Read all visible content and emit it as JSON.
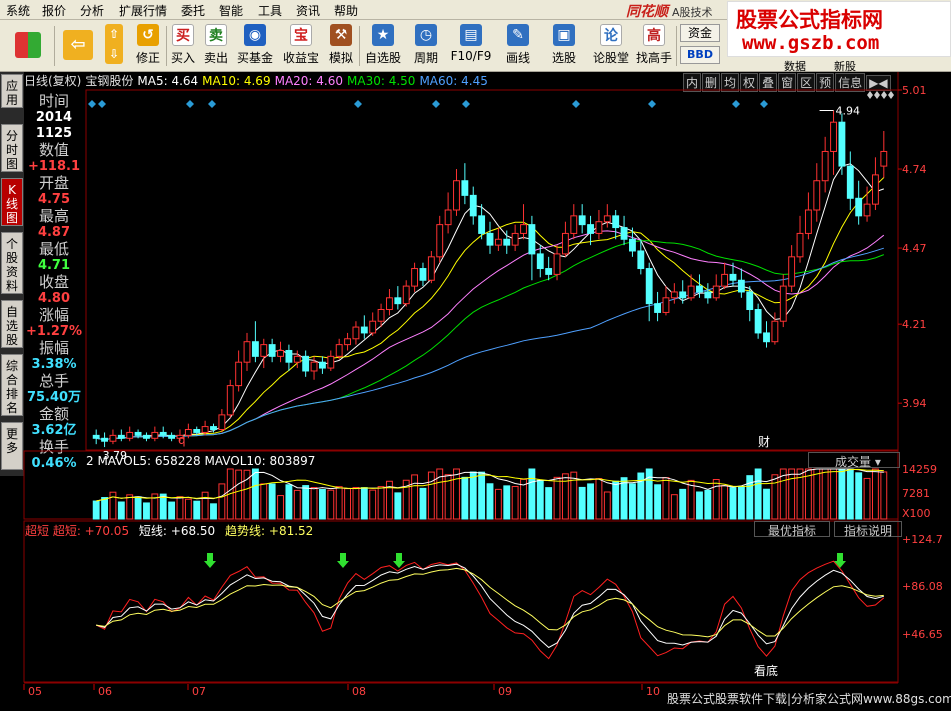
{
  "menu": [
    "系统",
    "报价",
    "分析",
    "扩展行情",
    "委托",
    "智能",
    "工具",
    "资讯",
    "帮助"
  ],
  "brand": {
    "name": "同花顺",
    "sub": "A股技术"
  },
  "watermark": {
    "title": "股票公式指标网",
    "url": "www.gszb.com"
  },
  "toolbar": {
    "buttons": [
      {
        "label": "修正",
        "icon": "refresh-icon",
        "color": "#e8a000",
        "glyph": "↺"
      },
      {
        "label": "买入",
        "icon": "buy-icon",
        "color": "#cc2020",
        "glyph": "买"
      },
      {
        "label": "卖出",
        "icon": "sell-icon",
        "color": "#208020",
        "glyph": "卖"
      },
      {
        "label": "买基金",
        "icon": "fund-icon",
        "color": "#2060c0",
        "glyph": "◉"
      },
      {
        "label": "收益宝",
        "icon": "profit-icon",
        "color": "#d02020",
        "glyph": "宝"
      },
      {
        "label": "模拟",
        "icon": "hammer-icon",
        "color": "#a05020",
        "glyph": "⚒"
      },
      {
        "label": "自选股",
        "icon": "star-folder-icon",
        "color": "#3070c0",
        "glyph": "★"
      },
      {
        "label": "周期",
        "icon": "clock-icon",
        "color": "#3070c0",
        "glyph": "◷"
      },
      {
        "label": "F10/F9",
        "icon": "f10-icon",
        "color": "#3070c0",
        "glyph": "▤"
      },
      {
        "label": "画线",
        "icon": "pen-icon",
        "color": "#3070c0",
        "glyph": "✎"
      },
      {
        "label": "选股",
        "icon": "monitor-icon",
        "color": "#3070c0",
        "glyph": "▣"
      },
      {
        "label": "论股堂",
        "icon": "forum-icon",
        "color": "#3070c0",
        "glyph": "论"
      },
      {
        "label": "找高手",
        "icon": "expert-icon",
        "color": "#c02020",
        "glyph": "高"
      }
    ],
    "extra": [
      "资金",
      "BBD",
      "数据",
      "新股"
    ]
  },
  "left_tabs": [
    "应用",
    "分时图",
    "K线图",
    "个股资料",
    "自选股",
    "综合排名",
    "更多"
  ],
  "stock": {
    "name": "宝钢股份",
    "period": "日线(复权)"
  },
  "ma_line": {
    "ma5": "MA5: 4.64",
    "ma10": "MA10: 4.69",
    "ma20": "MA20: 4.60",
    "ma30": "MA30: 4.50",
    "ma60": "MA60: 4.45"
  },
  "right_tools": [
    "内",
    "删",
    "均",
    "权",
    "叠",
    "窗",
    "区",
    "预",
    "信息"
  ],
  "info": [
    {
      "label": "时间",
      "value": "2014",
      "value2": "1125",
      "color": "#ffffff"
    },
    {
      "label": "数值",
      "value": "+118.1",
      "color": "#ff4040"
    },
    {
      "label": "开盘",
      "value": "4.75",
      "color": "#ff4040"
    },
    {
      "label": "最高",
      "value": "4.87",
      "color": "#ff4040"
    },
    {
      "label": "最低",
      "value": "4.71",
      "color": "#40ff40"
    },
    {
      "label": "收盘",
      "value": "4.80",
      "color": "#ff4040"
    },
    {
      "label": "涨幅",
      "value": "+1.27%",
      "color": "#ff4040"
    },
    {
      "label": "振幅",
      "value": "3.38%",
      "color": "#40e0ff"
    },
    {
      "label": "总手",
      "value": "75.40万",
      "color": "#40e0ff"
    },
    {
      "label": "金额",
      "value": "3.62亿",
      "color": "#40e0ff"
    },
    {
      "label": "换手",
      "value": "0.46%",
      "color": "#40e0ff"
    }
  ],
  "price_axis": [
    "5.01",
    "4.74",
    "4.47",
    "4.21",
    "3.94"
  ],
  "price_annotations": {
    "high": "4.94",
    "low": "3.79",
    "marker_q": "q",
    "marker_cai": "财"
  },
  "volume": {
    "header": "2 MAVOL5: 658228  MAVOL10: 803897",
    "tab": "成交量",
    "axis": [
      "14259",
      "7281",
      "X100"
    ]
  },
  "indicator": {
    "header_name": "超短 超短: +70.05",
    "short": "短线: +68.50",
    "trend": "趋势线: +81.52",
    "buttons": [
      "最优指标",
      "指标说明"
    ],
    "axis": [
      "+124.7",
      "+86.08",
      "+46.65"
    ],
    "label_bottom": "看底"
  },
  "months": [
    "05",
    "06",
    "07",
    "08",
    "09",
    "10"
  ],
  "footer": "股票公式股票软件下载|分析家公式网www.88gs.com",
  "colors": {
    "up": "#ff3232",
    "down": "#54ffff",
    "ma5": "#ffffff",
    "ma10": "#ffff00",
    "ma20": "#ff80ff",
    "ma30": "#00e000",
    "ma60": "#4fa0ff",
    "grid": "#8b0000",
    "indicator_red": "#ff2020",
    "indicator_white": "#ffffff",
    "indicator_yellow": "#ffff60"
  },
  "chart_data": {
    "type": "candlestick",
    "title": "宝钢股份 日线(复权)",
    "ylim": [
      3.78,
      5.01
    ],
    "candles": [
      [
        3.83,
        3.82,
        3.85,
        3.8
      ],
      [
        3.82,
        3.81,
        3.84,
        3.79
      ],
      [
        3.81,
        3.83,
        3.85,
        3.8
      ],
      [
        3.83,
        3.82,
        3.85,
        3.81
      ],
      [
        3.82,
        3.84,
        3.86,
        3.81
      ],
      [
        3.84,
        3.83,
        3.85,
        3.82
      ],
      [
        3.83,
        3.82,
        3.84,
        3.81
      ],
      [
        3.82,
        3.84,
        3.86,
        3.81
      ],
      [
        3.84,
        3.83,
        3.86,
        3.82
      ],
      [
        3.83,
        3.82,
        3.84,
        3.81
      ],
      [
        3.82,
        3.83,
        3.85,
        3.81
      ],
      [
        3.83,
        3.85,
        3.87,
        3.82
      ],
      [
        3.85,
        3.84,
        3.86,
        3.83
      ],
      [
        3.84,
        3.86,
        3.88,
        3.83
      ],
      [
        3.86,
        3.85,
        3.87,
        3.84
      ],
      [
        3.85,
        3.9,
        3.92,
        3.84
      ],
      [
        3.9,
        4.0,
        4.02,
        3.89
      ],
      [
        4.0,
        4.08,
        4.12,
        3.98
      ],
      [
        4.08,
        4.15,
        4.18,
        4.05
      ],
      [
        4.15,
        4.1,
        4.22,
        4.08
      ],
      [
        4.1,
        4.14,
        4.16,
        4.06
      ],
      [
        4.14,
        4.1,
        4.16,
        4.08
      ],
      [
        4.1,
        4.12,
        4.15,
        4.08
      ],
      [
        4.12,
        4.08,
        4.14,
        4.05
      ],
      [
        4.08,
        4.1,
        4.12,
        4.06
      ],
      [
        4.1,
        4.05,
        4.12,
        4.03
      ],
      [
        4.05,
        4.08,
        4.1,
        4.02
      ],
      [
        4.08,
        4.06,
        4.1,
        4.04
      ],
      [
        4.06,
        4.1,
        4.12,
        4.05
      ],
      [
        4.1,
        4.14,
        4.16,
        4.09
      ],
      [
        4.14,
        4.16,
        4.18,
        4.12
      ],
      [
        4.16,
        4.2,
        4.22,
        4.14
      ],
      [
        4.2,
        4.18,
        4.24,
        4.16
      ],
      [
        4.18,
        4.22,
        4.25,
        4.17
      ],
      [
        4.22,
        4.26,
        4.28,
        4.2
      ],
      [
        4.26,
        4.3,
        4.33,
        4.24
      ],
      [
        4.3,
        4.28,
        4.34,
        4.26
      ],
      [
        4.28,
        4.34,
        4.36,
        4.27
      ],
      [
        4.34,
        4.4,
        4.42,
        4.32
      ],
      [
        4.4,
        4.36,
        4.42,
        4.34
      ],
      [
        4.36,
        4.44,
        4.46,
        4.35
      ],
      [
        4.44,
        4.55,
        4.58,
        4.42
      ],
      [
        4.55,
        4.6,
        4.66,
        4.52
      ],
      [
        4.6,
        4.7,
        4.74,
        4.58
      ],
      [
        4.7,
        4.65,
        4.76,
        4.62
      ],
      [
        4.65,
        4.58,
        4.68,
        4.55
      ],
      [
        4.58,
        4.52,
        4.62,
        4.5
      ],
      [
        4.52,
        4.48,
        4.56,
        4.45
      ],
      [
        4.48,
        4.5,
        4.54,
        4.46
      ],
      [
        4.5,
        4.48,
        4.53,
        4.45
      ],
      [
        4.48,
        4.52,
        4.55,
        4.46
      ],
      [
        4.52,
        4.55,
        4.62,
        4.5
      ],
      [
        4.55,
        4.45,
        4.58,
        4.36
      ],
      [
        4.45,
        4.4,
        4.48,
        4.37
      ],
      [
        4.4,
        4.38,
        4.44,
        4.36
      ],
      [
        4.38,
        4.45,
        4.48,
        4.36
      ],
      [
        4.45,
        4.52,
        4.56,
        4.44
      ],
      [
        4.52,
        4.58,
        4.62,
        4.5
      ],
      [
        4.58,
        4.55,
        4.62,
        4.52
      ],
      [
        4.55,
        4.52,
        4.58,
        4.48
      ],
      [
        4.52,
        4.56,
        4.6,
        4.5
      ],
      [
        4.56,
        4.58,
        4.62,
        4.54
      ],
      [
        4.58,
        4.54,
        4.6,
        4.5
      ],
      [
        4.54,
        4.5,
        4.58,
        4.48
      ],
      [
        4.5,
        4.46,
        4.54,
        4.44
      ],
      [
        4.46,
        4.4,
        4.5,
        4.38
      ],
      [
        4.4,
        4.28,
        4.42,
        4.22
      ],
      [
        4.28,
        4.25,
        4.32,
        4.22
      ],
      [
        4.25,
        4.3,
        4.34,
        4.24
      ],
      [
        4.3,
        4.32,
        4.35,
        4.28
      ],
      [
        4.32,
        4.3,
        4.36,
        4.28
      ],
      [
        4.3,
        4.34,
        4.38,
        4.29
      ],
      [
        4.34,
        4.32,
        4.38,
        4.3
      ],
      [
        4.32,
        4.3,
        4.35,
        4.28
      ],
      [
        4.3,
        4.34,
        4.38,
        4.29
      ],
      [
        4.34,
        4.38,
        4.42,
        4.33
      ],
      [
        4.38,
        4.36,
        4.42,
        4.34
      ],
      [
        4.36,
        4.32,
        4.4,
        4.3
      ],
      [
        4.32,
        4.26,
        4.34,
        4.22
      ],
      [
        4.26,
        4.18,
        4.28,
        4.16
      ],
      [
        4.18,
        4.15,
        4.22,
        4.13
      ],
      [
        4.15,
        4.22,
        4.25,
        4.14
      ],
      [
        4.22,
        4.34,
        4.38,
        4.2
      ],
      [
        4.34,
        4.44,
        4.48,
        4.32
      ],
      [
        4.44,
        4.52,
        4.58,
        4.42
      ],
      [
        4.52,
        4.6,
        4.66,
        4.5
      ],
      [
        4.6,
        4.7,
        4.76,
        4.56
      ],
      [
        4.7,
        4.8,
        4.85,
        4.66
      ],
      [
        4.8,
        4.9,
        4.94,
        4.72
      ],
      [
        4.9,
        4.75,
        4.93,
        4.72
      ],
      [
        4.75,
        4.64,
        4.8,
        4.6
      ],
      [
        4.64,
        4.58,
        4.7,
        4.55
      ],
      [
        4.58,
        4.62,
        4.68,
        4.56
      ],
      [
        4.62,
        4.72,
        4.78,
        4.6
      ],
      [
        4.75,
        4.8,
        4.87,
        4.71
      ]
    ]
  }
}
